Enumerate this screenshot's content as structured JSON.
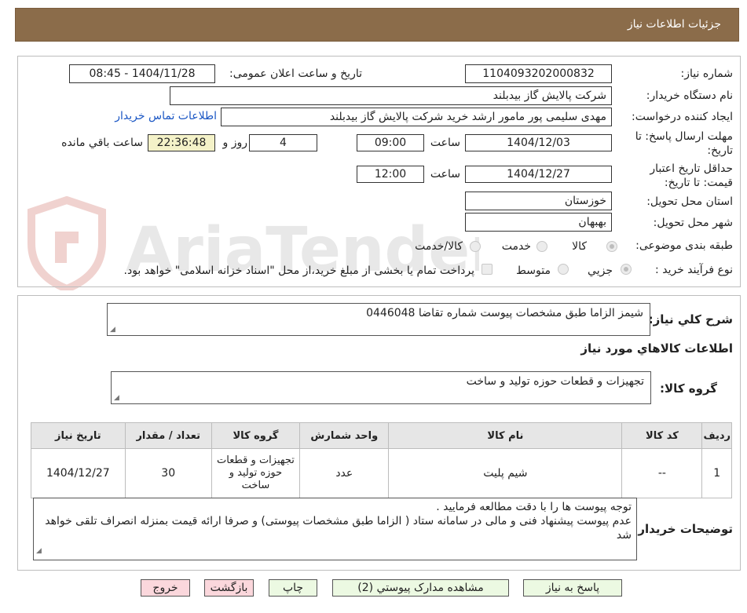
{
  "header": {
    "title": "جزئیات اطلاعات نیاز"
  },
  "form": {
    "need_number_label": "شماره نیاز:",
    "need_number_value": "1104093202000832",
    "announce_label": "تاریخ و ساعت اعلان عمومی:",
    "announce_value": "1404/11/28 - 08:45",
    "buyer_org_label": "نام دستگاه خریدار:",
    "buyer_org_value": "شرکت پالایش گاز بیدبلند",
    "creator_label": "ایجاد کننده درخواست:",
    "creator_value": "مهدی سلیمی پور مامور ارشد خرید شرکت پالایش گاز بیدبلند",
    "contact_link": "اطلاعات تماس خریدار",
    "deadline_label": "مهلت ارسال پاسخ: تا تاریخ:",
    "deadline_date": "1404/12/03",
    "time_label": "ساعت",
    "deadline_time": "09:00",
    "days_value": "4",
    "days_label": "روز و",
    "remaining_time": "22:36:48",
    "remaining_label": "ساعت باقي مانده",
    "validity_label": "حداقل تاریخ اعتبار قیمت: تا تاریخ:",
    "validity_date": "1404/12/27",
    "validity_time": "12:00",
    "province_label": "استان محل تحویل:",
    "province_value": "خوزستان",
    "city_label": "شهر محل تحویل:",
    "city_value": "بهبهان",
    "category_label": "طبقه بندی موضوعی:",
    "category_options": [
      "کالا",
      "خدمت",
      "کالا/خدمت"
    ],
    "process_label": "نوع فرآیند خرید :",
    "process_options": [
      "جزیي",
      "متوسط"
    ],
    "payment_note": "پرداخت تمام یا بخشی از مبلغ خرید،از محل \"اسناد خزانه اسلامی\" خواهد بود."
  },
  "description": {
    "label": "شرح کلي نياز:",
    "value": "شیمز الزاما طبق مشخصات پیوست شماره تقاضا 0446048"
  },
  "goods": {
    "section_title": "اطلاعات کالاهاي مورد نياز",
    "group_label": "گروه کالا:",
    "group_value": "تجهیزات و قطعات حوزه تولید و ساخت"
  },
  "table": {
    "headers": [
      "رديف",
      "کد کالا",
      "نام کالا",
      "واحد شمارش",
      "گروه کالا",
      "تعداد / مقدار",
      "تاريخ نياز"
    ],
    "rows": [
      [
        "1",
        "--",
        "شیم پلیت",
        "عدد",
        "تجهیزات و قطعات حوزه تولید و ساخت",
        "30",
        "1404/12/27"
      ]
    ]
  },
  "buyer_notes": {
    "label": "توضيحات خريدار:",
    "line1": "توجه پیوست ها  را با دقت مطالعه فرمایید .",
    "line2": "عدم پیوست پیشنهاد فنی و مالی در سامانه ستاد ( الزاما طبق مشخصات پیوستی)  و صرفا ارائه قیمت بمنزله انصراف تلقی خواهد شد"
  },
  "buttons": {
    "reply": "پاسخ به نياز",
    "attachments": "مشاهده مدارک پيوستي (2)",
    "print": "چاپ",
    "back": "بازگشت",
    "exit": "خروج"
  },
  "watermark": {
    "text": "AriaTender.neT"
  },
  "colors": {
    "header_bg": "#8b6c4a",
    "link": "#1a56c4",
    "remaining_bg": "#f4f2c8",
    "button_green": "#ecf9e2",
    "button_red": "#fbd7dc"
  }
}
